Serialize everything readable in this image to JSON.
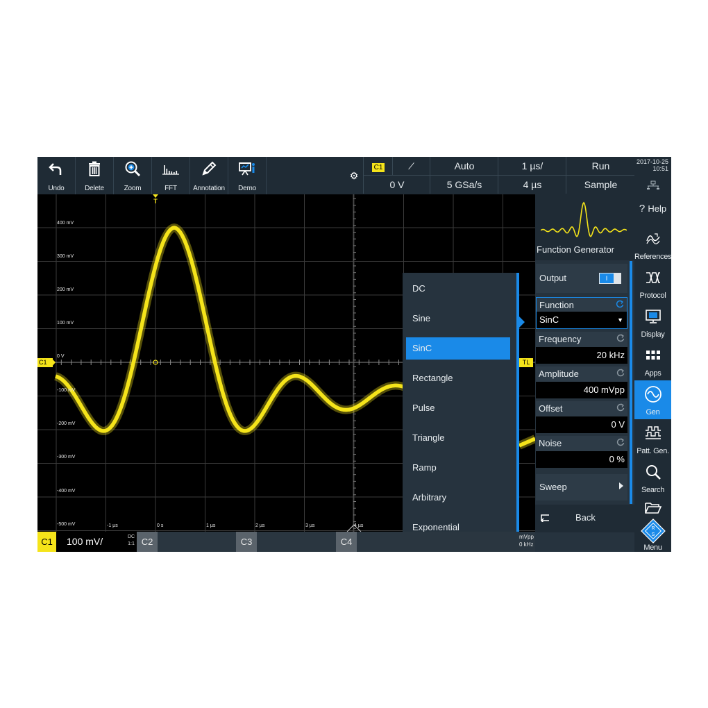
{
  "toolbar": {
    "buttons": [
      {
        "label": "Undo",
        "icon": "undo-icon"
      },
      {
        "label": "Delete",
        "icon": "trash-icon"
      },
      {
        "label": "Zoom",
        "icon": "zoom-icon"
      },
      {
        "label": "FFT",
        "icon": "fft-icon"
      },
      {
        "label": "Annotation",
        "icon": "pen-icon"
      },
      {
        "label": "Demo",
        "icon": "demo-icon"
      }
    ]
  },
  "status": {
    "channel": "C1",
    "trigger_level": "0 V",
    "trigger_mode": "Auto",
    "sample_rate": "5 GSa/s",
    "time_scale": "1 µs/",
    "time_position": "4 µs",
    "run_state": "Run",
    "acquisition": "Sample",
    "date": "2017-10-25",
    "time": "10:51"
  },
  "plot": {
    "y_labels": [
      "400 mV",
      "300 mV",
      "200 mV",
      "100 mV",
      "0 V",
      "-100 mV",
      "-200 mV",
      "-300 mV",
      "-400 mV",
      "-500 mV"
    ],
    "x_labels": [
      "-1 µs",
      "0 s",
      "1 µs",
      "2 µs",
      "3 µs",
      "4 µs"
    ],
    "channel_marker": "C1",
    "trigger_marker": "T",
    "tl_marker": "TL",
    "waveform_color": "#f5e41a",
    "partial_texts": [
      "mVpp",
      "0 kHz"
    ]
  },
  "function_list": {
    "items": [
      "DC",
      "Sine",
      "SinC",
      "Rectangle",
      "Pulse",
      "Triangle",
      "Ramp",
      "Arbitrary",
      "Exponential"
    ],
    "selected": "SinC"
  },
  "gen_panel": {
    "title": "Function Generator",
    "output_label": "Output",
    "function_label": "Function",
    "function_value": "SinC",
    "frequency_label": "Frequency",
    "frequency_value": "20 kHz",
    "amplitude_label": "Amplitude",
    "amplitude_value": "400 mVpp",
    "offset_label": "Offset",
    "offset_value": "0 V",
    "noise_label": "Noise",
    "noise_value": "0 %",
    "sweep_label": "Sweep",
    "back_label": "Back"
  },
  "side_menu": {
    "items": [
      {
        "label": "Help",
        "icon": "help-icon"
      },
      {
        "label": "References",
        "icon": "references-icon"
      },
      {
        "label": "Protocol",
        "icon": "protocol-icon"
      },
      {
        "label": "Display",
        "icon": "display-icon"
      },
      {
        "label": "Apps",
        "icon": "apps-icon"
      },
      {
        "label": "Gen",
        "icon": "gen-icon"
      },
      {
        "label": "Patt. Gen.",
        "icon": "pattern-gen-icon"
      },
      {
        "label": "Search",
        "icon": "search-icon"
      },
      {
        "label": "Menu",
        "icon": "menu-logo-icon"
      }
    ],
    "active": "Gen",
    "help_glyph": "?"
  },
  "bottom_bar": {
    "c1_label": "C1",
    "c1_scale": "100 mV/",
    "c1_coupling": "DC",
    "c1_probe": "1:1",
    "c2_label": "C2",
    "c3_label": "C3",
    "c4_label": "C4"
  }
}
